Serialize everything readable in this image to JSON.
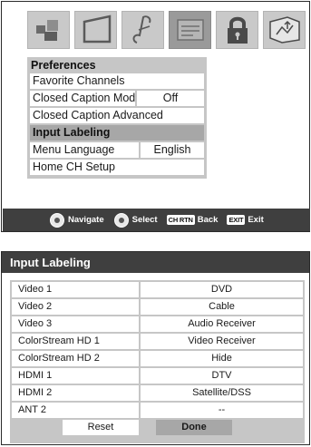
{
  "icons": [
    {
      "name": "picture-icon"
    },
    {
      "name": "sound-icon"
    },
    {
      "name": "music-note-icon"
    },
    {
      "name": "preferences-icon"
    },
    {
      "name": "lock-icon"
    },
    {
      "name": "setup-icon"
    }
  ],
  "preferences": {
    "title": "Preferences",
    "items": [
      {
        "label": "Favorite Channels",
        "value": ""
      },
      {
        "label": "Closed Caption Mode",
        "value": "Off"
      },
      {
        "label": "Closed Caption Advanced",
        "value": ""
      },
      {
        "label": "Input Labeling",
        "value": ""
      },
      {
        "label": "Menu Language",
        "value": "English"
      },
      {
        "label": "Home CH Setup",
        "value": ""
      }
    ],
    "selected": "Input Labeling"
  },
  "nav": {
    "navigate": "Navigate",
    "select": "Select",
    "back_key": "CH RTN",
    "back": "Back",
    "exit_key": "EXIT",
    "exit": "Exit"
  },
  "input_labeling": {
    "title": "Input Labeling",
    "rows": [
      {
        "name": "Video 1",
        "value": "DVD"
      },
      {
        "name": "Video 2",
        "value": "Cable"
      },
      {
        "name": "Video 3",
        "value": "Audio Receiver"
      },
      {
        "name": "ColorStream HD 1",
        "value": "Video Receiver"
      },
      {
        "name": "ColorStream HD 2",
        "value": "Hide"
      },
      {
        "name": "HDMI 1",
        "value": "DTV"
      },
      {
        "name": "HDMI 2",
        "value": "Satellite/DSS"
      },
      {
        "name": "ANT 2",
        "value": "--"
      }
    ],
    "reset_label": "Reset",
    "done_label": "Done"
  }
}
